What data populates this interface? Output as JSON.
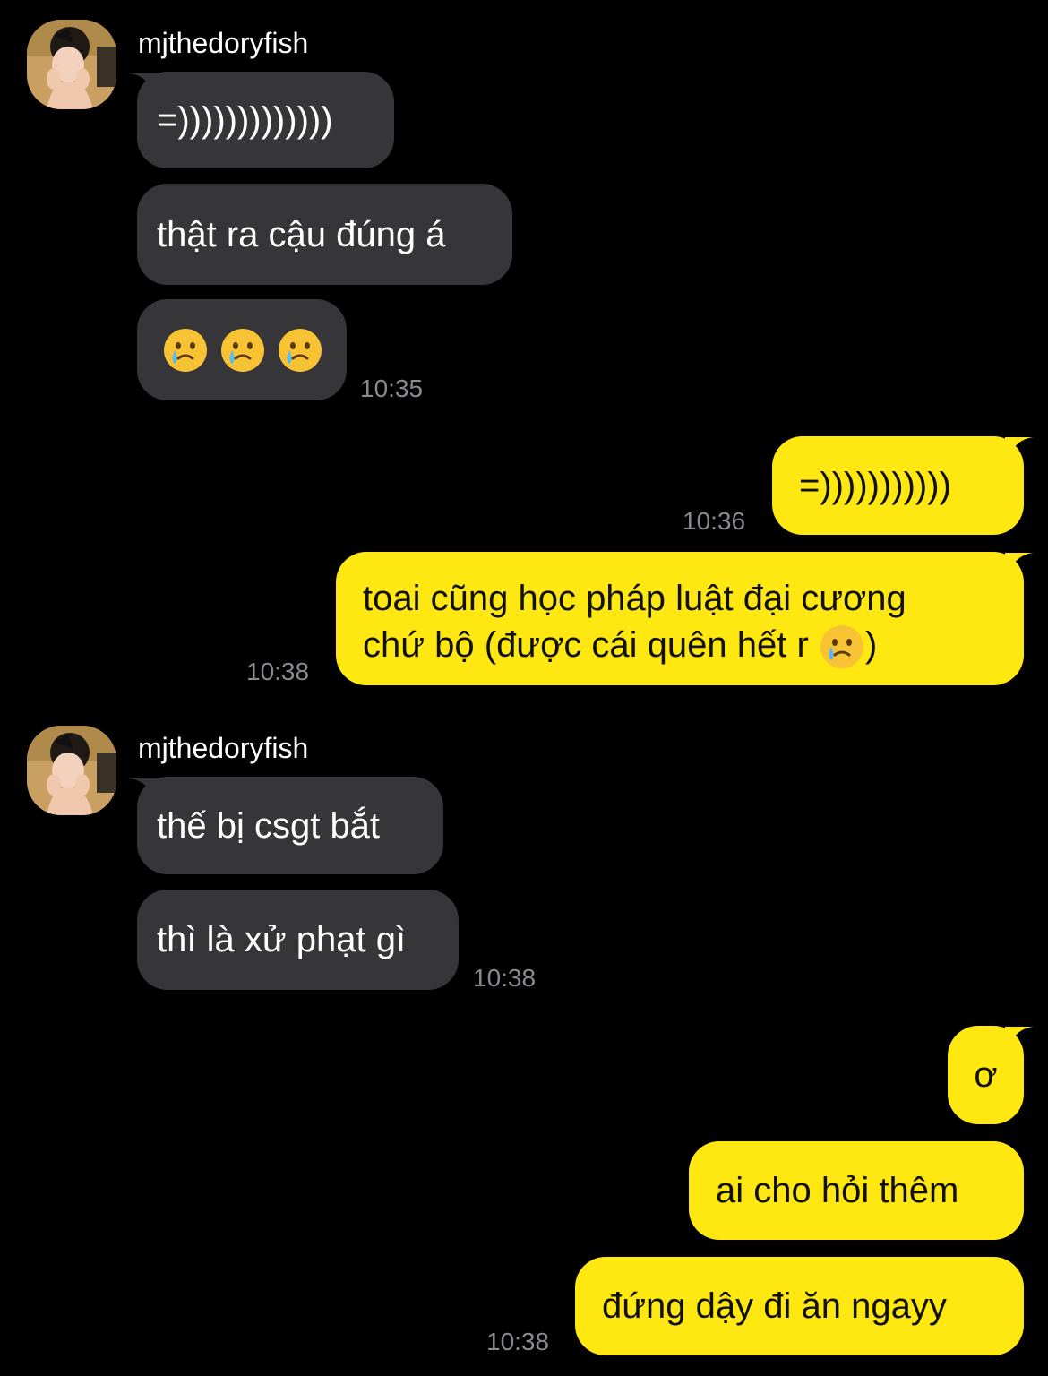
{
  "chat": {
    "sender_name": "mjthedoryfish",
    "messages": [
      {
        "text": "=)))))))))))))"
      },
      {
        "text": "thật ra cậu đúng á"
      },
      {
        "icons": [
          "crying-smile-emoji",
          "crying-smile-emoji",
          "crying-smile-emoji"
        ],
        "time": "10:35"
      },
      {
        "text": "=)))))))))))",
        "time": "10:36"
      },
      {
        "line1": "toai cũng học pháp luật đại cương",
        "line2_before": "chứ bộ (được cái quên hết r ",
        "line2_icon": "crying-smile-emoji",
        "line2_after": ")",
        "time": "10:38"
      },
      {
        "text": "thế bị csgt bắt"
      },
      {
        "text": "thì là xử phạt gì",
        "time": "10:38"
      },
      {
        "text": "ơ"
      },
      {
        "text": "ai cho hỏi thêm"
      },
      {
        "text": "đứng dậy đi ăn ngayy",
        "time": "10:38"
      }
    ]
  },
  "colors": {
    "background": "#000000",
    "incoming_bubble": "#363638",
    "outgoing_bubble": "#ffe812",
    "timestamp": "#8a8a8e"
  }
}
